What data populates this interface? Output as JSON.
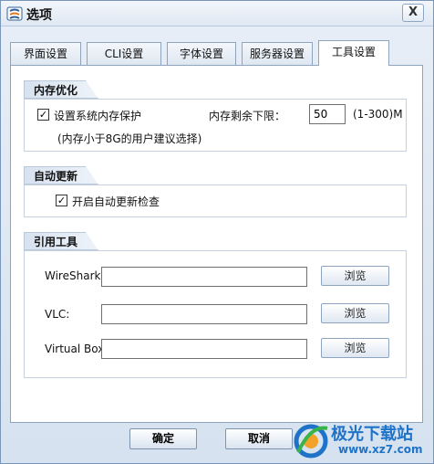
{
  "window": {
    "title": "选项",
    "close_label": "X"
  },
  "tabs": [
    {
      "label": "界面设置"
    },
    {
      "label": "CLI设置"
    },
    {
      "label": "字体设置"
    },
    {
      "label": "服务器设置"
    },
    {
      "label": "工具设置",
      "active": true
    }
  ],
  "memory": {
    "title": "内存优化",
    "protect_label": "设置系统内存保护",
    "protect_checked": "✓",
    "hint": "(内存小于8G的用户建议选择)",
    "min_label": "内存剩余下限：",
    "min_value": "50",
    "range_label": "(1-300)M"
  },
  "update": {
    "title": "自动更新",
    "check_label": "开启自动更新检查",
    "check_checked": "✓"
  },
  "tools": {
    "title": "引用工具",
    "items": [
      {
        "label": "WireShark:",
        "value": "",
        "browse": "浏览"
      },
      {
        "label": "VLC:",
        "value": "",
        "browse": "浏览"
      },
      {
        "label": "Virtual Box:",
        "value": "",
        "browse": "浏览"
      }
    ]
  },
  "footer": {
    "ok_label": "确定",
    "cancel_label": "取消"
  },
  "watermark": {
    "name": "极光下载站",
    "url": "www.xz7.com"
  },
  "colors": {
    "accent": "#1e73c8",
    "panel_bg": "#ffffff",
    "window_bg": "#dbe6f2"
  }
}
